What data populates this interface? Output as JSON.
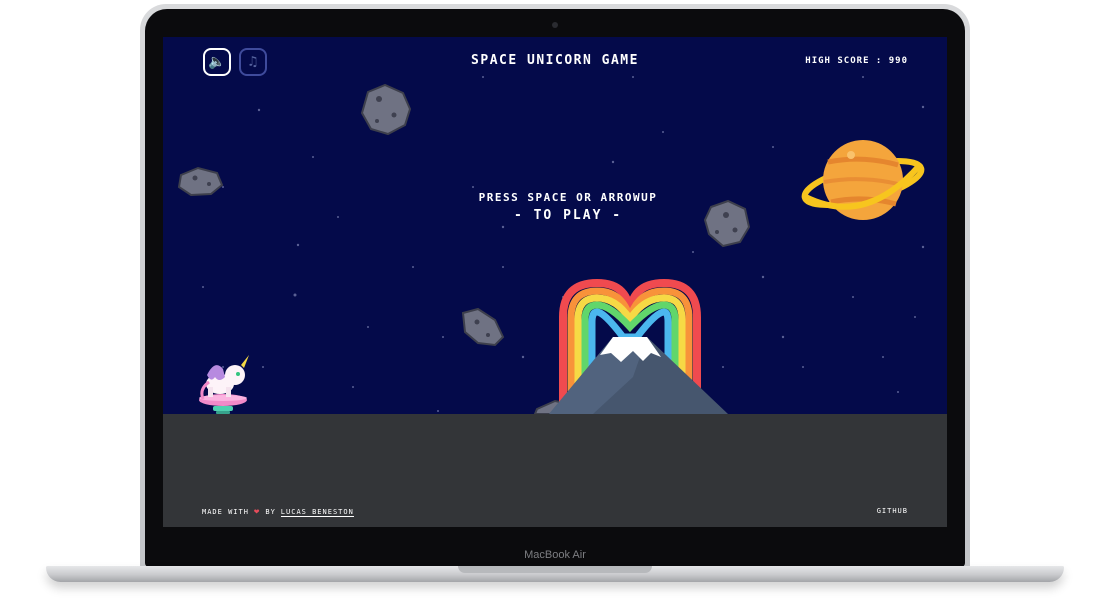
{
  "device": {
    "label": "MacBook Air"
  },
  "game": {
    "title": "SPACE UNICORN GAME",
    "high_score_label": "HIGH SCORE : 990",
    "prompt_line1": "PRESS SPACE OR ARROWUP",
    "prompt_line2": "- TO PLAY -"
  },
  "controls": {
    "sound_icon": "speaker-icon",
    "music_icon": "music-note-icon",
    "sound_glyph": "🔈",
    "music_glyph": "♫"
  },
  "footer": {
    "made_with": "MADE WITH",
    "by": "BY",
    "author": "LUCAS BENESTON",
    "github": "GITHUB"
  },
  "colors": {
    "sky": "#040a4a",
    "ground": "#333538",
    "planet": "#f4a53c",
    "ring": "#f7c51e",
    "heart": "#e74c5b"
  }
}
